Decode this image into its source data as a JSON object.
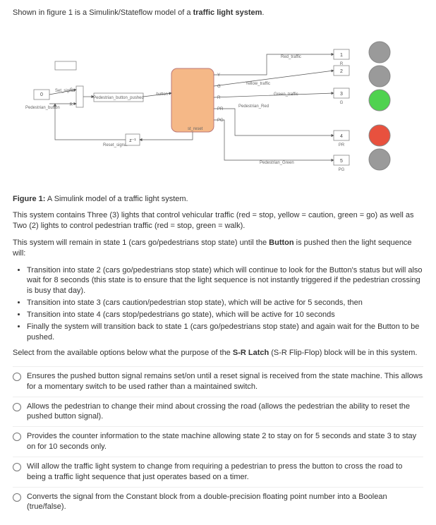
{
  "intro_prefix": "Shown in figure 1 is a Simulink/Stateflow model of a ",
  "intro_bold": "traffic light system",
  "intro_suffix": ".",
  "diagram": {
    "blocks": {
      "constant": "0",
      "set_signal": "Set_signal",
      "pedestrian_button": "Pedestrian_button",
      "pedestrian_button_pushed": "Pedestrian_button_pushed",
      "reset_signal": "Reset_signal",
      "button_port": "button",
      "sr_latch": "z⁻¹",
      "out_y": "Y",
      "out_g": "G",
      "out_pr": "PR",
      "out_pg": "PG",
      "out_reset": "st_reset"
    },
    "signals": {
      "red_traffic": "Red_traffic",
      "yellow_traffic": "Yellow_traffic",
      "green_traffic": "Green_traffic",
      "pedestrian_red": "Pedestrian_Red",
      "pedestrian_green": "Pedestrian_Green"
    },
    "term": {
      "t1": "1",
      "t2": "2",
      "t3": "3",
      "t4": "4",
      "t5": "5",
      "t_r": "R",
      "t_g": "G",
      "t_pr": "PR",
      "t_pg": "PG"
    },
    "lights": {
      "red": "#9a9a9a",
      "yellow": "#9a9a9a",
      "green": "#4fd24f",
      "ped_red": "#e8513e",
      "ped_green": "#9a9a9a"
    }
  },
  "caption_bold": "Figure 1:",
  "caption_text": " A Simulink model of a traffic light system.",
  "para1": "This system contains Three (3) lights that control vehicular traffic (red = stop, yellow = caution, green = go) as well as Two (2) lights to control pedestrian traffic (red = stop, green = walk).",
  "para2_prefix": "This system will remain in state 1 (cars go/pedestrians stop state) until the ",
  "para2_bold": "Button",
  "para2_suffix": " is pushed then the light sequence will:",
  "bullets": [
    "Transition into state 2 (cars go/pedestrians stop state) which will continue to look for the Button's status but will also wait for 8 seconds (this state is to ensure that the light sequence is not instantly triggered if the pedestrian crossing is busy that day).",
    "Transition into state 3 (cars caution/pedestrian stop state), which will be active for 5 seconds, then",
    "Transition into state 4 (cars stop/pedestrians go state), which will be active for 10 seconds",
    "Finally the system will transition back to state 1 (cars go/pedestrians stop state) and again wait for the Button to be pushed."
  ],
  "select_prompt_prefix": "Select from the available options below what the purpose of the ",
  "select_prompt_bold": "S-R Latch",
  "select_prompt_mid": " (S-R Flip-Flop) block will be in this system.",
  "options": [
    "Ensures the pushed button signal remains set/on until a reset signal is received from the state machine. This allows for a momentary switch to be used rather than a maintained switch.",
    "Allows the pedestrian to change their mind about crossing the road (allows the pedestrian the ability to reset the pushed button signal).",
    "Provides the counter information to the state machine allowing state 2 to stay on for 5 seconds and state 3 to stay on for 10 seconds only.",
    "Will allow the traffic light system to change from requiring a pedestrian to press the button to cross the road to being a traffic light sequence that just operates based on a timer.",
    "Converts the signal from the Constant block from a double-precision floating point number into a Boolean (true/false)."
  ]
}
